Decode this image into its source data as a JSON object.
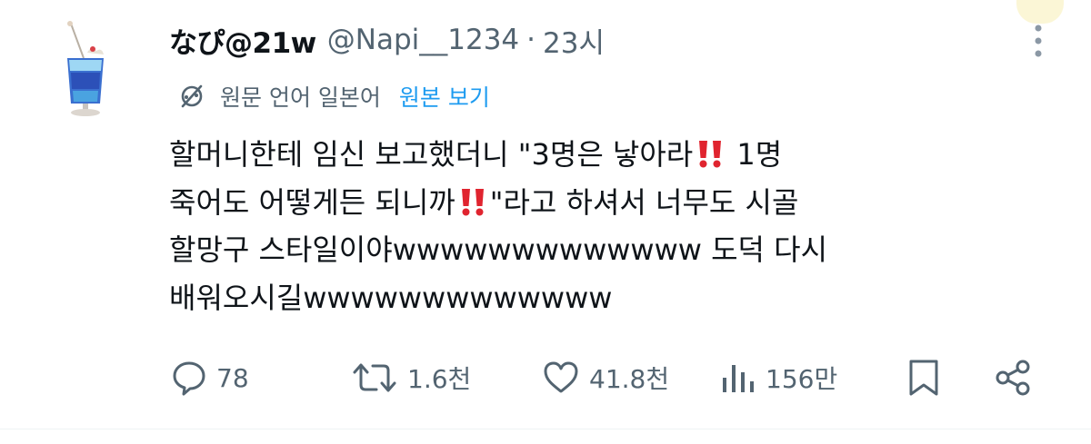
{
  "tweet": {
    "author_name": "なぴ@21w",
    "handle": "@Napi__1234",
    "separator": "·",
    "time": "23시",
    "translation_note": "원문 언어 일본어",
    "view_original": "원본 보기",
    "lines": [
      {
        "a": "할머니한테 임신 보고했더니 \"3명은 낳아라",
        "b": " 1명"
      },
      {
        "a": "죽어도 어떻게든 되니까",
        "b": "\"라고 하셔서 너무도 시골"
      },
      {
        "a": "할망구 스타일이야wwwwwwwwwwwww 도덕 다시",
        "b": ""
      },
      {
        "a": "배워오시길wwwwwwwwwwwww",
        "b": ""
      }
    ]
  },
  "actions": {
    "replies": "78",
    "retweets": "1.6천",
    "likes": "41.8천",
    "views": "156만"
  },
  "icons": {
    "reply": "speech-bubble-icon",
    "retweet": "retweet-arrows-icon",
    "like": "heart-icon",
    "views": "bar-chart-icon",
    "bookmark": "bookmark-icon",
    "share": "share-icon",
    "translate": "translate-slash-icon",
    "more": "more-dots-icon",
    "emoji": "double-exclamation-emoji"
  },
  "colors": {
    "text": "#0f1419",
    "secondary": "#536471",
    "link": "#1d9bf0",
    "emoji": "#e0242f"
  }
}
